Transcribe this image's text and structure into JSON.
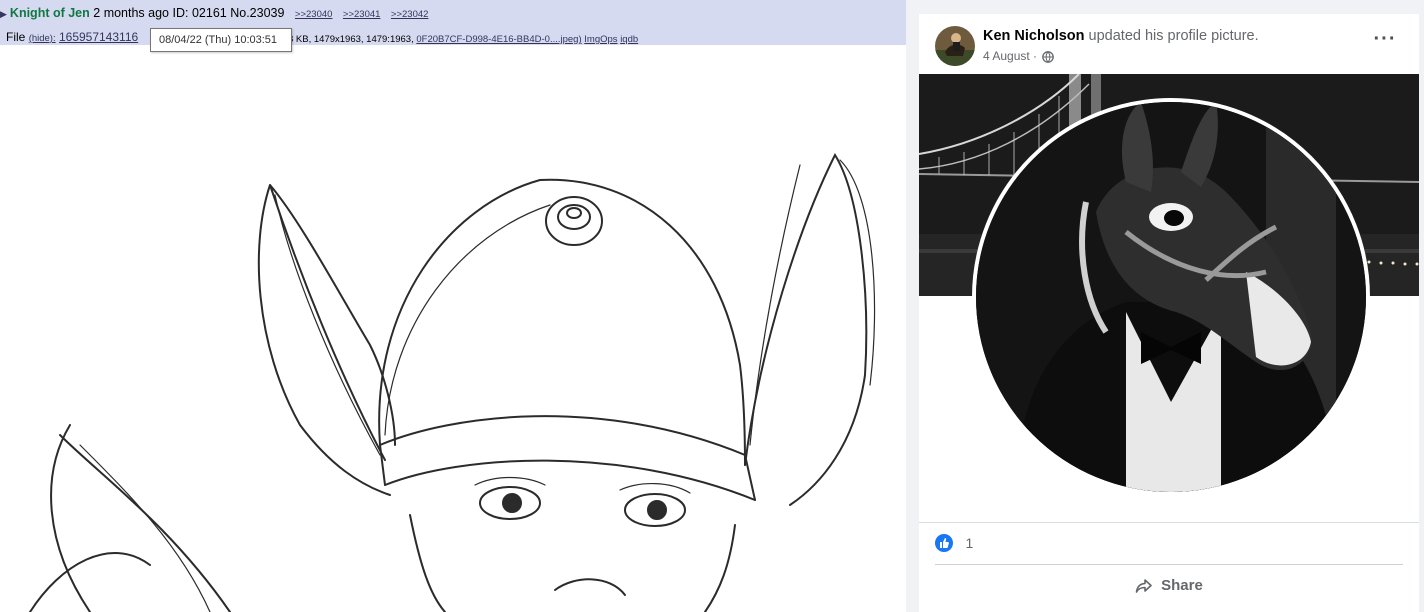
{
  "post": {
    "name": "Knight of Jen",
    "age": "2 months ago",
    "id_label": "ID:",
    "id_value": "02161",
    "number": "No.23039",
    "backlinks": [
      ">>23040",
      ">>23041",
      ">>23042"
    ],
    "file_label": "File",
    "hide_label": "(hide):",
    "filename": "165957143116",
    "file_meta": "8 KB, 1479x1963, 1479:1963,",
    "orig_name": "0F20B7CF-D998-4E16-BB4D-0....jpeg)",
    "imgops": "ImgOps",
    "iqdb": "iqdb",
    "tooltip": "08/04/22 (Thu) 10:03:51"
  },
  "fb": {
    "author": "Ken Nicholson",
    "action": "updated his profile picture.",
    "date": "4 August ·",
    "more_label": "···",
    "like_count": "1",
    "share_label": "Share",
    "icons": [
      "globe-icon",
      "like-icon",
      "share-icon",
      "more-icon"
    ],
    "colors": {
      "accent": "#1877f2",
      "header_bg": "#d6daf0",
      "name_green": "#117743"
    }
  }
}
